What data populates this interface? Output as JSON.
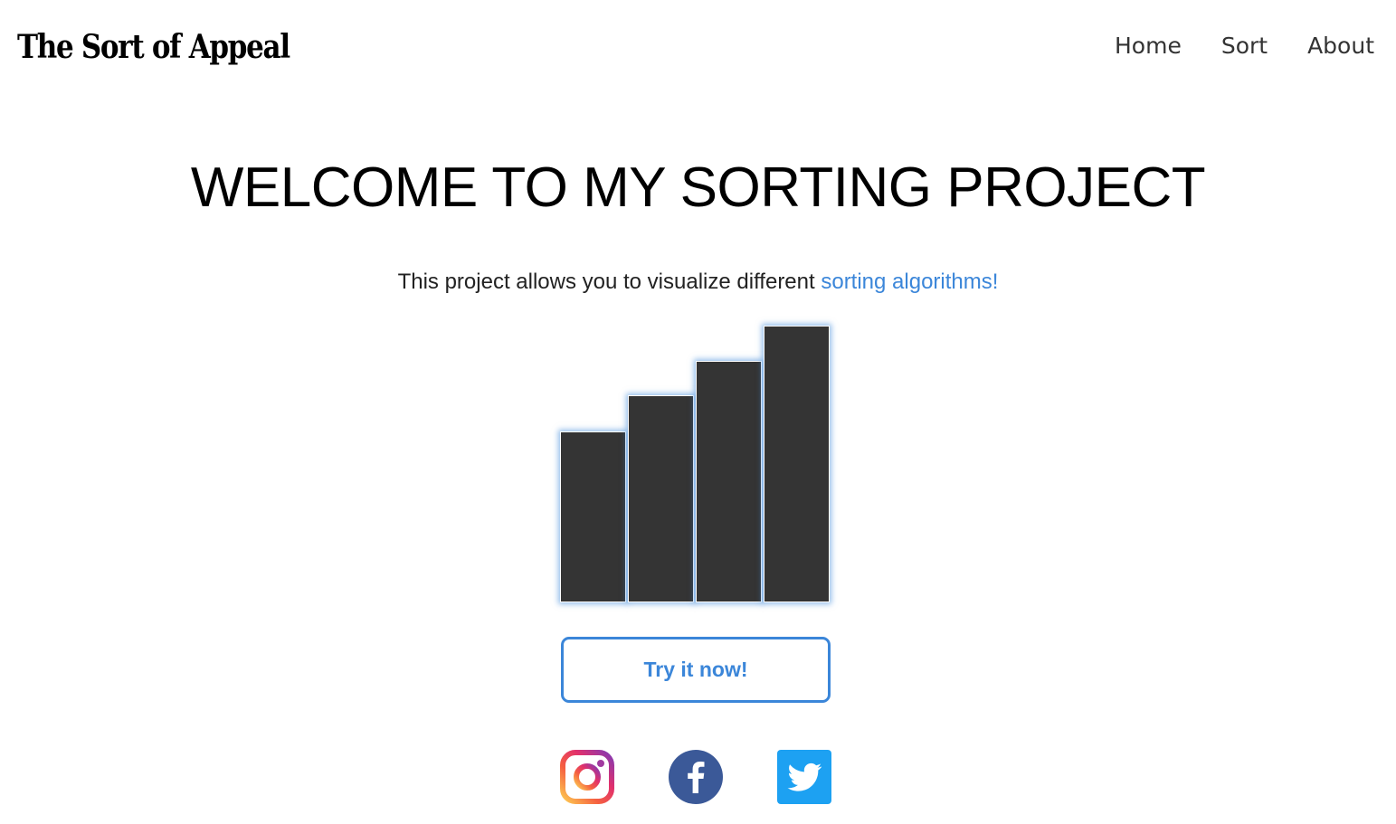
{
  "header": {
    "brand": "The Sort of Appeal",
    "nav": [
      {
        "label": "Home"
      },
      {
        "label": "Sort"
      },
      {
        "label": "About"
      }
    ]
  },
  "hero": {
    "title": "WELCOME TO MY SORTING PROJECT",
    "subtitle_prefix": "This project allows you to visualize different ",
    "subtitle_link": "sorting algorithms!"
  },
  "demo_bars": {
    "values": [
      185,
      224,
      261,
      299
    ],
    "color": "#343434",
    "glow_color": "#3b86d9"
  },
  "cta": {
    "label": "Try it now!"
  },
  "social": [
    {
      "name": "instagram-icon"
    },
    {
      "name": "facebook-icon"
    },
    {
      "name": "twitter-icon"
    }
  ],
  "colors": {
    "accent": "#3b86d9",
    "facebook": "#3b5998",
    "twitter": "#1da1f2"
  }
}
